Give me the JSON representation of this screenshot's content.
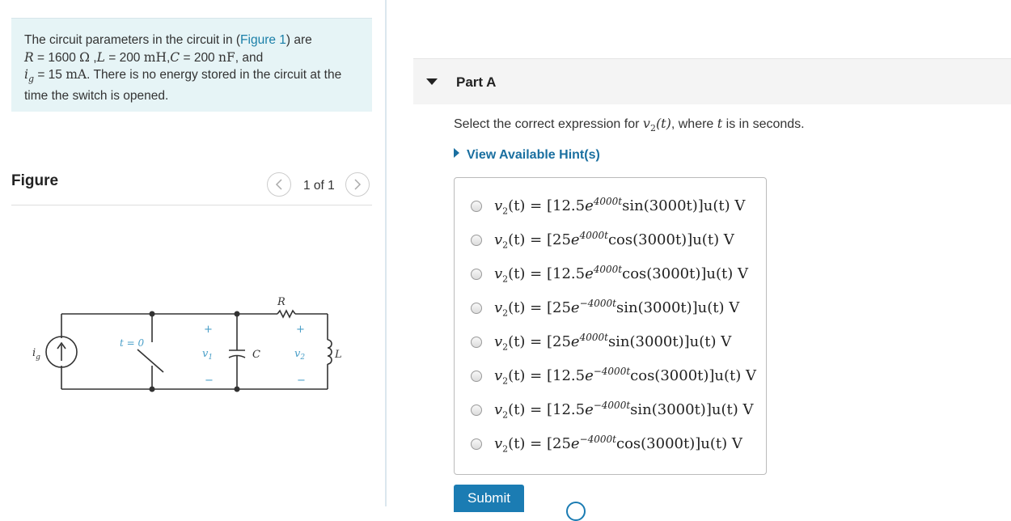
{
  "intro": {
    "t1": "The circuit parameters in the circuit in (",
    "link": "Figure 1",
    "t2": ") are",
    "R_sym": "R",
    "R_eq": " = 1600 ",
    "R_unit": "Ω",
    "comma1": " ,",
    "L_sym": "L",
    "L_eq": " = 200 ",
    "L_unit": "mH",
    "comma2": ",",
    "C_sym": "C",
    "C_eq": " = 200 ",
    "C_unit": "nF",
    "and": ", and",
    "ig_sym": "i",
    "ig_sub": "g",
    "ig_eq": " = 15 ",
    "ig_unit": "mA",
    "t3": ". There is no energy stored in the circuit at the time the switch is opened."
  },
  "figure": {
    "title": "Figure",
    "count": "1 of 1",
    "prev_icon": "chevron-left-icon",
    "next_icon": "chevron-right-icon",
    "circuit_labels": {
      "source": "i",
      "source_sub": "g",
      "switch": "t = 0",
      "v1": "v",
      "v1_sub": "1",
      "v2": "v",
      "v2_sub": "2",
      "C": "C",
      "R": "R",
      "L": "L",
      "plus": "+",
      "minus": "−"
    }
  },
  "partA": {
    "title": "Part A",
    "q1": "Select the correct expression for ",
    "q_v": "v",
    "q_sub": "2",
    "q_arg": "(t)",
    "q2": ", where ",
    "q_t": "t",
    "q3": " is in seconds.",
    "hint": "View Available Hint(s)",
    "options": [
      {
        "lhs": "v",
        "sub": "2",
        "lhs2": "(t) = [12.5",
        "e": "e",
        "exp": "4000t",
        "fn": "sin(3000",
        "rest": "t)]u(t) V"
      },
      {
        "lhs": "v",
        "sub": "2",
        "lhs2": "(t) = [25",
        "e": "e",
        "exp": "4000t",
        "fn": "cos(3000",
        "rest": "t)]u(t) V"
      },
      {
        "lhs": "v",
        "sub": "2",
        "lhs2": "(t) = [12.5",
        "e": "e",
        "exp": "4000t",
        "fn": "cos(3000",
        "rest": "t)]u(t) V"
      },
      {
        "lhs": "v",
        "sub": "2",
        "lhs2": "(t) = [25",
        "e": "e",
        "exp": "−4000t",
        "fn": "sin(3000",
        "rest": "t)]u(t) V"
      },
      {
        "lhs": "v",
        "sub": "2",
        "lhs2": "(t) = [25",
        "e": "e",
        "exp": "4000t",
        "fn": "sin(3000",
        "rest": "t)]u(t) V"
      },
      {
        "lhs": "v",
        "sub": "2",
        "lhs2": "(t) = [12.5",
        "e": "e",
        "exp": "−4000t",
        "fn": "cos(3000",
        "rest": "t)]u(t) V"
      },
      {
        "lhs": "v",
        "sub": "2",
        "lhs2": "(t) = [12.5",
        "e": "e",
        "exp": "−4000t",
        "fn": "sin(3000",
        "rest": "t)]u(t) V"
      },
      {
        "lhs": "v",
        "sub": "2",
        "lhs2": "(t) = [25",
        "e": "e",
        "exp": "−4000t",
        "fn": "cos(3000",
        "rest": "t)]u(t) V"
      }
    ],
    "submit": "Submit"
  },
  "colors": {
    "accent": "#1b7cb3",
    "link": "#1a7fa8",
    "intro_bg": "#e6f4f6"
  }
}
